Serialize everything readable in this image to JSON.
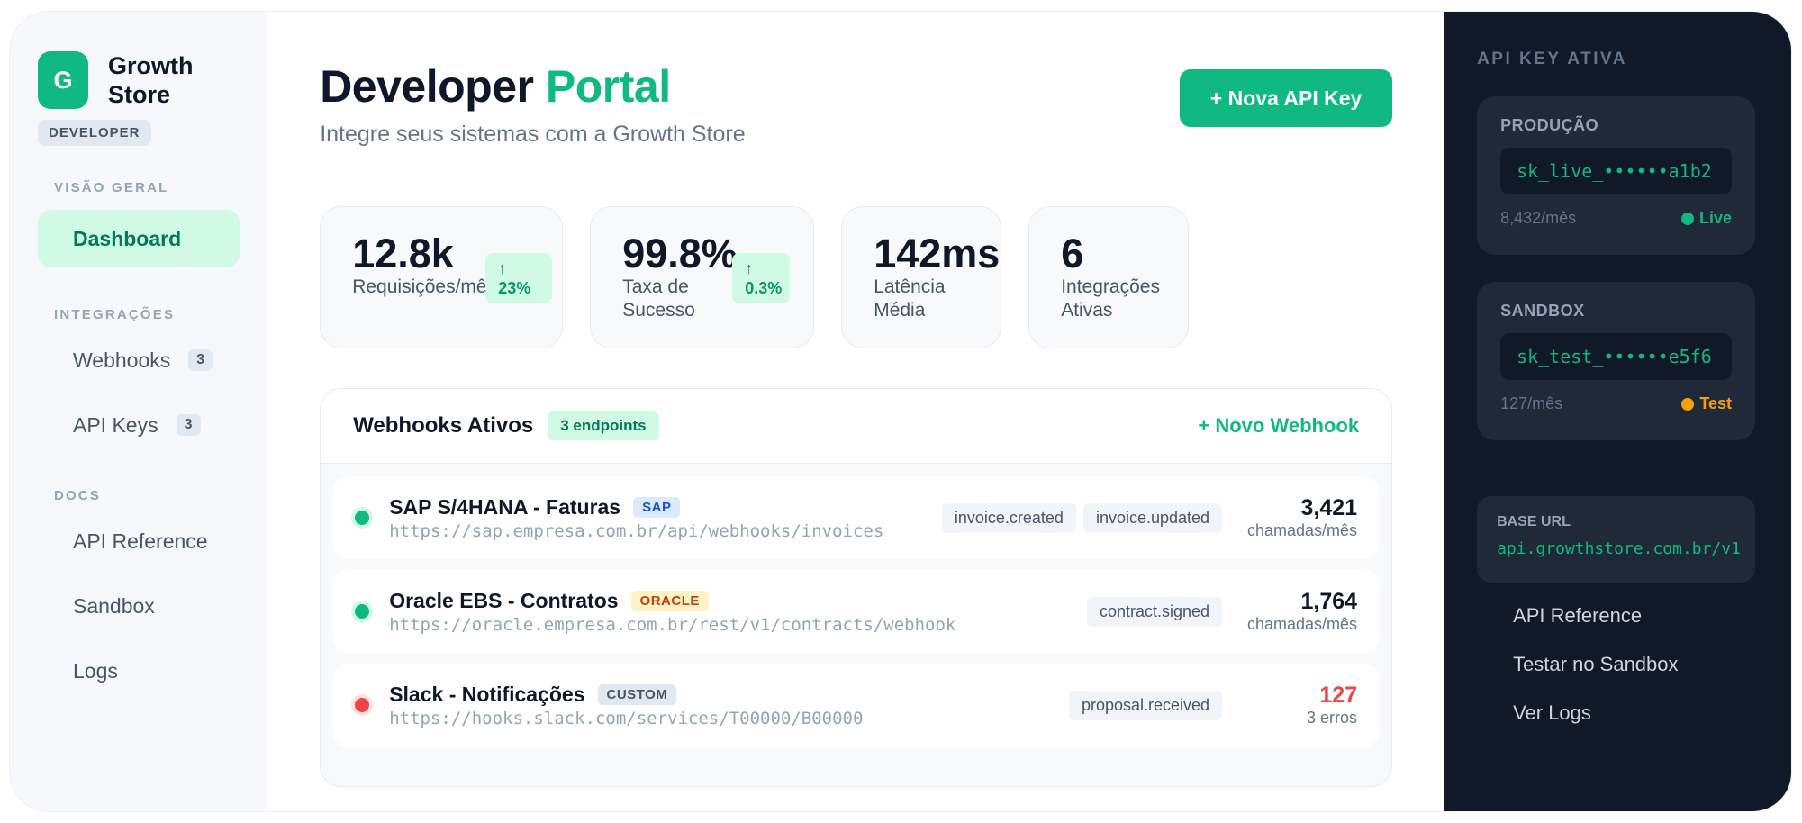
{
  "brand": {
    "logo_letter": "G",
    "name": "Growth Store",
    "role": "DEVELOPER"
  },
  "sidebar": {
    "sections": [
      {
        "title": "VISÃO GERAL",
        "items": [
          {
            "label": "Dashboard",
            "active": true
          }
        ]
      },
      {
        "title": "INTEGRAÇÕES",
        "items": [
          {
            "label": "Webhooks",
            "count": "3"
          },
          {
            "label": "API Keys",
            "count": "3"
          }
        ]
      },
      {
        "title": "DOCS",
        "items": [
          {
            "label": "API Reference"
          },
          {
            "label": "Sandbox"
          },
          {
            "label": "Logs"
          }
        ]
      }
    ]
  },
  "header": {
    "title_main": "Developer",
    "title_accent": "Portal",
    "subtitle": "Integre seus sistemas com a Growth Store",
    "primary_button": "+ Nova API Key"
  },
  "stats": [
    {
      "value": "12.8k",
      "label": "Requisições/mês",
      "trend_arrow": "↑",
      "trend": "23%"
    },
    {
      "value": "99.8%",
      "label_line1": "Taxa de",
      "label_line2": "Sucesso",
      "trend_arrow": "↑",
      "trend": "0.3%"
    },
    {
      "value": "142ms",
      "label_line1": "Latência",
      "label_line2": "Média"
    },
    {
      "value": "6",
      "label_line1": "Integrações",
      "label_line2": "Ativas"
    }
  ],
  "webhooks": {
    "title": "Webhooks Ativos",
    "badge": "3 endpoints",
    "new_link": "+ Novo Webhook",
    "rows": [
      {
        "name": "SAP S/4HANA - Faturas",
        "tag": "SAP",
        "url": "https://sap.empresa.com.br/api/webhooks/invoices",
        "events": [
          "invoice.created",
          "invoice.updated"
        ],
        "value": "3,421",
        "value_label": "chamadas/mês",
        "status": "ok"
      },
      {
        "name": "Oracle EBS - Contratos",
        "tag": "ORACLE",
        "url": "https://oracle.empresa.com.br/rest/v1/contracts/webhook",
        "events": [
          "contract.signed"
        ],
        "value": "1,764",
        "value_label": "chamadas/mês",
        "status": "ok"
      },
      {
        "name": "Slack - Notificações",
        "tag": "CUSTOM",
        "url": "https://hooks.slack.com/services/T00000/B00000",
        "events": [
          "proposal.received"
        ],
        "value": "127",
        "value_label": "3 erros",
        "status": "error"
      }
    ]
  },
  "right_panel": {
    "title": "API KEY ATIVA",
    "keys": [
      {
        "env": "PRODUÇÃO",
        "key": "sk_live_••••••a1b2",
        "usage": "8,432/mês",
        "status": "Live"
      },
      {
        "env": "SANDBOX",
        "key": "sk_test_••••••e5f6",
        "usage": "127/mês",
        "status": "Test"
      }
    ],
    "base_label": "BASE URL",
    "base_url": "api.growthstore.com.br/v1",
    "links": [
      "API Reference",
      "Testar no Sandbox",
      "Ver Logs"
    ]
  },
  "colors": {
    "accent": "#10b981",
    "dark_panel": "#111827",
    "error": "#ef4444",
    "warning": "#f59e0b"
  }
}
